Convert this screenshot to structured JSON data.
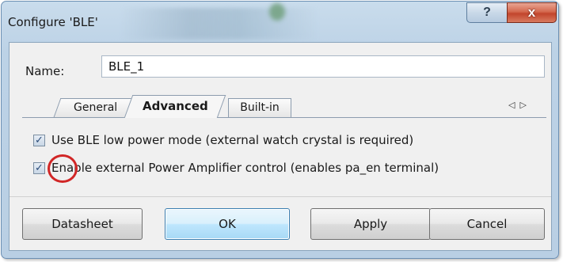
{
  "window": {
    "title": "Configure 'BLE'",
    "help_glyph": "?",
    "close_glyph": "x"
  },
  "name_field": {
    "label": "Name:",
    "value": "BLE_1"
  },
  "tabs": [
    {
      "label": "General",
      "active": false
    },
    {
      "label": "Advanced",
      "active": true
    },
    {
      "label": "Built-in",
      "active": false
    }
  ],
  "tab_scroll": {
    "left": "◁",
    "right": "▷"
  },
  "advanced": {
    "options": [
      {
        "label": "Use BLE low power mode (external watch crystal is required)",
        "checked": true
      },
      {
        "label": "Enable external Power Amplifier control (enables pa_en terminal)",
        "checked": true
      }
    ],
    "check_glyph": "✓",
    "highlight_color": "#d12626"
  },
  "buttons": {
    "datasheet": "Datasheet",
    "ok": "OK",
    "apply": "Apply",
    "cancel": "Cancel"
  }
}
